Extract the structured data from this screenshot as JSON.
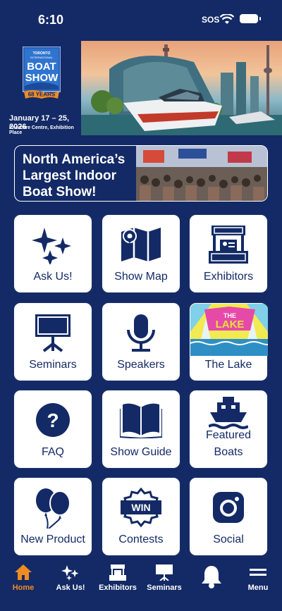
{
  "status": {
    "time": "6:10",
    "sos": "SOS"
  },
  "header": {
    "logo_text": [
      "TORONTO",
      "INTERNATIONAL",
      "BOAT",
      "SHOW",
      "68 YEARS"
    ],
    "date": "January 17 – 25, 2026",
    "venue": "Enercare Centre, Exhibition Place"
  },
  "banner": {
    "text": "North America’s Largest Indoor Boat Show!"
  },
  "tiles": [
    {
      "label": "Ask Us!",
      "icon": "sparkle-icon"
    },
    {
      "label": "Show Map",
      "icon": "map-icon"
    },
    {
      "label": "Exhibitors",
      "icon": "booth-icon"
    },
    {
      "label": "Seminars",
      "icon": "presentation-icon"
    },
    {
      "label": "Speakers",
      "icon": "microphone-icon"
    },
    {
      "label": "The Lake",
      "icon": "lake-image",
      "image_text": "THE LAKE"
    },
    {
      "label": "FAQ",
      "icon": "question-icon"
    },
    {
      "label": "Show Guide",
      "icon": "book-icon"
    },
    {
      "label": "Featured Boats",
      "icon": "ship-icon"
    },
    {
      "label": "New Product",
      "icon": "balloons-icon"
    },
    {
      "label": "Contests",
      "icon": "win-badge-icon",
      "badge_text": "WIN"
    },
    {
      "label": "Social",
      "icon": "instagram-icon"
    }
  ],
  "tabbar": {
    "items": [
      {
        "label": "Home",
        "icon": "home-icon",
        "active": true
      },
      {
        "label": "Ask Us!",
        "icon": "sparkle-icon"
      },
      {
        "label": "Exhibitors",
        "icon": "booth-icon"
      },
      {
        "label": "Seminars",
        "icon": "presentation-icon"
      },
      {
        "label": "",
        "icon": "bell-icon"
      },
      {
        "label": "Menu",
        "icon": "menu-icon"
      }
    ]
  },
  "colors": {
    "navy": "#132a66",
    "orange": "#f08b23",
    "white": "#ffffff"
  }
}
